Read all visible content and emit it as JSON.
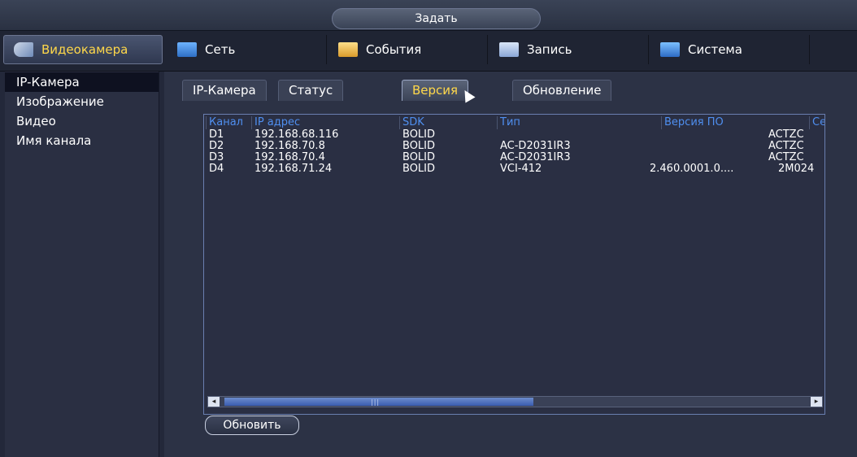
{
  "title": "Задать",
  "menu": {
    "items": [
      {
        "label": "Видеокамера",
        "icon": "camera-icon",
        "active": true
      },
      {
        "label": "Сеть",
        "icon": "network-icon",
        "active": false
      },
      {
        "label": "События",
        "icon": "events-icon",
        "active": false
      },
      {
        "label": "Запись",
        "icon": "record-icon",
        "active": false
      },
      {
        "label": "Система",
        "icon": "system-icon",
        "active": false
      }
    ]
  },
  "sidebar": {
    "items": [
      {
        "label": "IP-Камера",
        "active": true
      },
      {
        "label": "Изображение",
        "active": false
      },
      {
        "label": "Видео",
        "active": false
      },
      {
        "label": "Имя канала",
        "active": false
      }
    ]
  },
  "tabs": [
    {
      "label": "IP-Камера",
      "active": false
    },
    {
      "label": "Статус",
      "active": false
    },
    {
      "label": "Версия",
      "active": true
    },
    {
      "label": "Обновление",
      "active": false
    }
  ],
  "table": {
    "headers": [
      "Канал",
      "IP адрес",
      "SDK",
      "Тип",
      "Версия ПО",
      "Се"
    ],
    "rows": [
      [
        "D1",
        "192.168.68.116",
        "BOLID",
        "",
        "",
        "ACTZC"
      ],
      [
        "D2",
        "192.168.70.8",
        "BOLID",
        "AC-D2031IR3",
        "",
        "ACTZC"
      ],
      [
        "D3",
        "192.168.70.4",
        "BOLID",
        "AC-D2031IR3",
        "",
        "ACTZC"
      ],
      [
        "D4",
        "192.168.71.24",
        "BOLID",
        "VCI-412",
        "2.460.0001.0....",
        "2M024"
      ]
    ]
  },
  "scrollbar": {
    "grip": "|||",
    "left_arrow": "◂",
    "right_arrow": "▸"
  },
  "refresh_button": "Обновить",
  "colors": {
    "accent": "#ffd84a",
    "header_text": "#4f8ff0",
    "background": "#23283a"
  }
}
